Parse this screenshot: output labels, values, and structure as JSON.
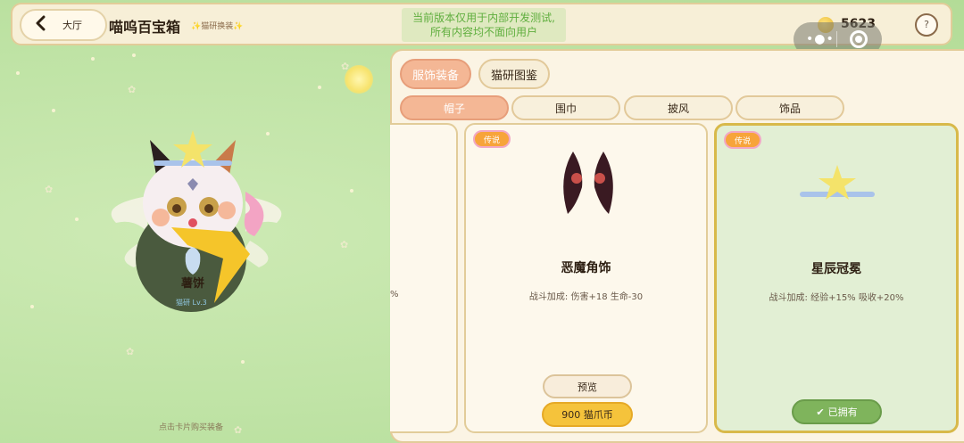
{
  "header": {
    "back_label": "大厅",
    "title": "喵呜百宝箱",
    "subtitle": "✨猫研换装✨",
    "notice": "当前版本仅用于内部开发测试,\n所有内容均不面向用户",
    "coins": "5623",
    "help_label": "?"
  },
  "capsule": {
    "more_icon": "more-dots-icon",
    "close_icon": "target-ring-icon"
  },
  "character": {
    "name": "薯饼",
    "sub": "猫研 Lv.3",
    "hint": "点击卡片购买装备"
  },
  "tabs": [
    {
      "label": "服饰装备",
      "active": true
    },
    {
      "label": "猫研图鉴",
      "active": false
    }
  ],
  "subtabs": [
    {
      "label": "帽子",
      "active": true
    },
    {
      "label": "围巾",
      "active": false
    },
    {
      "label": "披风",
      "active": false
    },
    {
      "label": "饰品",
      "active": false
    }
  ],
  "partial_card": {
    "stat_fragment": "%"
  },
  "cards": [
    {
      "rarity": "传说",
      "name": "恶魔角饰",
      "stat": "战斗加成: 伤害+18 生命-30",
      "preview_label": "预览",
      "buy_label": "900 猫爪币",
      "owned": false
    },
    {
      "rarity": "传说",
      "name": "星辰冠冕",
      "stat": "战斗加成: 经验+15% 吸收+20%",
      "owned_label": "已拥有",
      "owned": true
    }
  ],
  "colors": {
    "accent": "#f4b795",
    "legend_badge": "#f7a43a",
    "coin_button": "#f5c33b",
    "owned_button": "#7fb45c",
    "notice_text": "#5fae3e"
  }
}
